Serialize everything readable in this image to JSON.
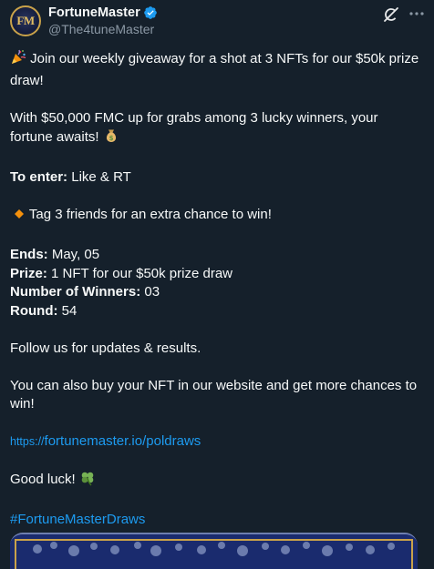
{
  "author": {
    "avatar_text": "FM",
    "display_name": "FortuneMaster",
    "handle": "@The4tuneMaster",
    "verified": true
  },
  "icons": {
    "verified": "verified-badge-icon",
    "grok": "grok-icon",
    "more": "more-options-icon",
    "party": "party-popper-emoji",
    "money": "money-bag-emoji",
    "diamond": "orange-diamond-emoji",
    "clover": "four-leaf-clover-emoji"
  },
  "tweet": {
    "intro": " Join our weekly giveaway for a shot at 3 NFTs for our $50k prize draw!",
    "prize_pool": "With $50,000 FMC up for grabs among 3 lucky winners, your fortune awaits! ",
    "to_enter_label": "To enter:",
    "to_enter_value": " Like & RT",
    "tag_line": " Tag 3 friends for an extra chance to win!",
    "ends_label": "Ends:",
    "ends_value": " May, 05",
    "prize_label": "Prize:",
    "prize_value": " 1 NFT for our $50k prize draw",
    "winners_label": "Number of Winners:",
    "winners_value": " 03",
    "round_label": "Round:",
    "round_value": " 54",
    "follow": "Follow us for updates & results.",
    "buy_nft": "You can also buy your NFT in our website and get more chances to win!",
    "link_protocol": "https://",
    "link_rest": "fortunemaster.io/poldraws",
    "good_luck": "Good luck! ",
    "hashtag": "#FortuneMasterDraws"
  },
  "colors": {
    "background": "#15202b",
    "text": "#f7f9f9",
    "secondary_text": "#8b98a5",
    "link": "#1d9bf0",
    "verified": "#1d9bf0"
  }
}
